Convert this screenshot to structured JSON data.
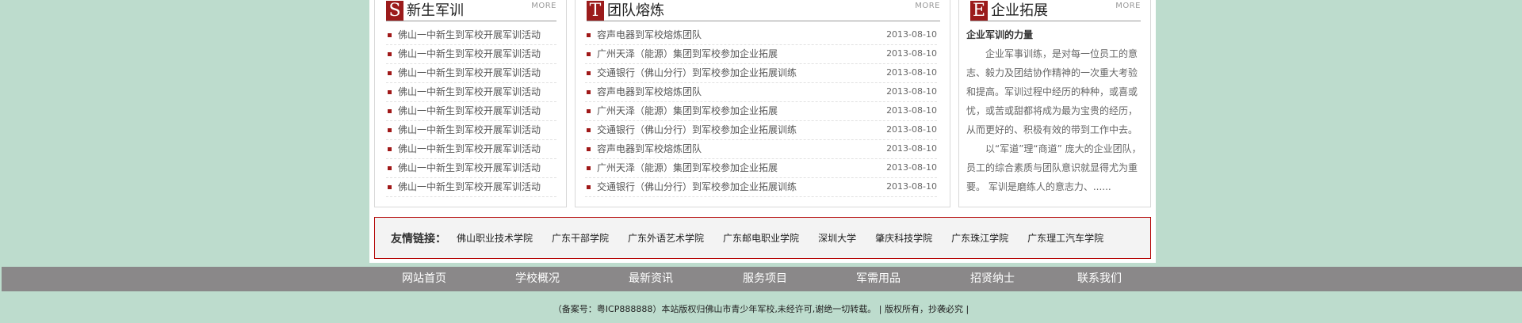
{
  "panels": {
    "training": {
      "badge": "S",
      "title": "新生军训",
      "more": "MORE",
      "items": [
        "佛山一中新生到军校开展军训活动",
        "佛山一中新生到军校开展军训活动",
        "佛山一中新生到军校开展军训活动",
        "佛山一中新生到军校开展军训活动",
        "佛山一中新生到军校开展军训活动",
        "佛山一中新生到军校开展军训活动",
        "佛山一中新生到军校开展军训活动",
        "佛山一中新生到军校开展军训活动",
        "佛山一中新生到军校开展军训活动"
      ]
    },
    "team": {
      "badge": "T",
      "title": "团队熔炼",
      "more": "MORE",
      "items": [
        {
          "text": "容声电器到军校熔炼团队",
          "date": "2013-08-10"
        },
        {
          "text": "广州天泽（能源）集团到军校参加企业拓展",
          "date": "2013-08-10"
        },
        {
          "text": "交通银行（佛山分行）到军校参加企业拓展训练",
          "date": "2013-08-10"
        },
        {
          "text": "容声电器到军校熔炼团队",
          "date": "2013-08-10"
        },
        {
          "text": "广州天泽（能源）集团到军校参加企业拓展",
          "date": "2013-08-10"
        },
        {
          "text": "交通银行（佛山分行）到军校参加企业拓展训练",
          "date": "2013-08-10"
        },
        {
          "text": "容声电器到军校熔炼团队",
          "date": "2013-08-10"
        },
        {
          "text": "广州天泽（能源）集团到军校参加企业拓展",
          "date": "2013-08-10"
        },
        {
          "text": "交通银行（佛山分行）到军校参加企业拓展训练",
          "date": "2013-08-10"
        }
      ]
    },
    "enterprise": {
      "badge": "E",
      "title": "企业拓展",
      "more": "MORE",
      "intro_title": "企业军训的力量",
      "para1": "企业军事训练，是对每一位员工的意志、毅力及团结协作精神的一次重大考验和提高。军训过程中经历的种种，或喜或忧，或苦或甜都将成为最为宝贵的经历，从而更好的、积极有效的带到工作中去。",
      "para2": "以“军道”理“商道” 庞大的企业团队，员工的综合素质与团队意识就显得尤为重要。 军训是磨练人的意志力、......"
    }
  },
  "links": {
    "label": "友情链接：",
    "items": [
      "佛山职业技术学院",
      "广东干部学院",
      "广东外语艺术学院",
      "广东邮电职业学院",
      "深圳大学",
      "肇庆科技学院",
      "广东珠江学院",
      "广东理工汽车学院"
    ]
  },
  "nav": [
    "网站首页",
    "学校概况",
    "最新资讯",
    "服务项目",
    "军需用品",
    "招贤纳士",
    "联系我们"
  ],
  "footer": "（备案号：粤ICP888888）本站版权归佛山市青少年军校,未经许可,谢绝一切转载。 | 版权所有，抄袭必究 |"
}
